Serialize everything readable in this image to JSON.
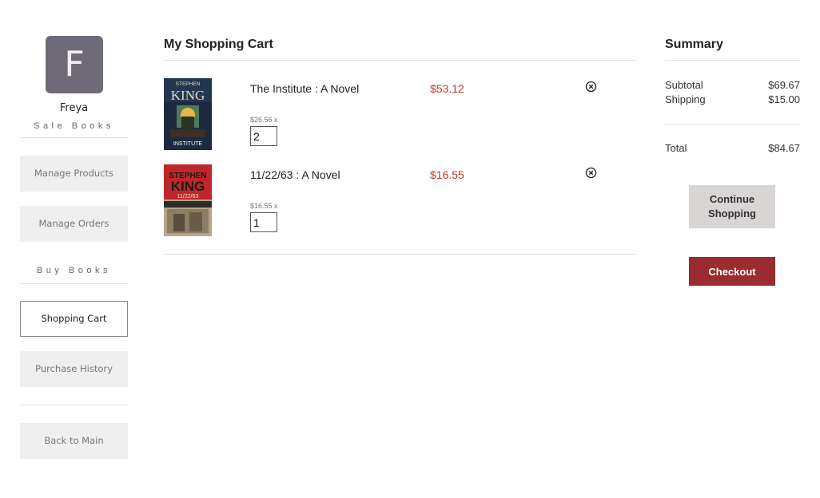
{
  "sidebar": {
    "avatar_letter": "F",
    "user_name": "Freya",
    "sale_section_label": "Sale Books",
    "buy_section_label": "Buy Books",
    "manage_products": "Manage Products",
    "manage_orders": "Manage Orders",
    "shopping_cart": "Shopping Cart",
    "purchase_history": "Purchase History",
    "back_to_main": "Back to Main"
  },
  "cart": {
    "title": "My Shopping Cart",
    "items": [
      {
        "title": "The Institute : A Novel",
        "line_total": "$53.12",
        "unit_price": "$26.56 x",
        "quantity": "2",
        "cover": {
          "author": "STEPHEN",
          "author2": "KING",
          "book": "INSTITUTE"
        }
      },
      {
        "title": "11/22/63 : A Novel",
        "line_total": "$16.55",
        "unit_price": "$16.55 x",
        "quantity": "1",
        "cover": {
          "author": "STEPHEN",
          "author2": "KING",
          "book": "11/22/63"
        }
      }
    ]
  },
  "summary": {
    "title": "Summary",
    "subtotal_label": "Subtotal",
    "subtotal_value": "$69.67",
    "shipping_label": "Shipping",
    "shipping_value": "$15.00",
    "total_label": "Total",
    "total_value": "$84.67",
    "continue_label": "Continue Shopping",
    "checkout_label": "Checkout"
  },
  "colors": {
    "accent_red": "#9a2b2e",
    "price_red": "#c0392b",
    "avatar_bg": "#6f6a78"
  }
}
